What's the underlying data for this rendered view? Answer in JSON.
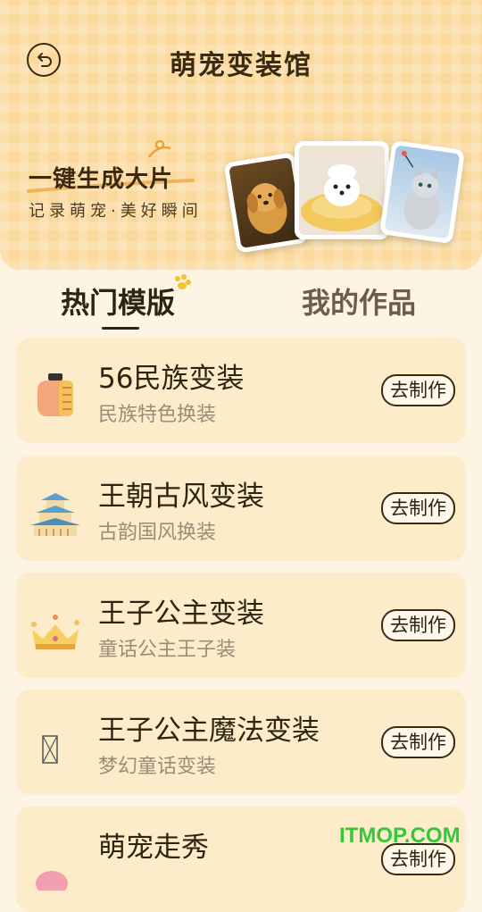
{
  "header": {
    "title": "萌宠变装馆",
    "back_icon": "back-arrow-icon",
    "banner": {
      "title": "一键生成大片",
      "subtitle": "记录萌宠·美好瞬间",
      "photos": [
        "golden-retriever-puppy",
        "white-puppy-in-bed",
        "kitten-with-toy"
      ]
    }
  },
  "tabs": [
    {
      "label": "热门模版",
      "active": true
    },
    {
      "label": "我的作品",
      "active": false
    }
  ],
  "templates": [
    {
      "name": "56民族变装",
      "desc": "民族特色换装",
      "action": "去制作",
      "icon": "ethnic-drum-icon"
    },
    {
      "name": "王朝古风变装",
      "desc": "古韵国风换装",
      "action": "去制作",
      "icon": "palace-icon"
    },
    {
      "name": "王子公主变装",
      "desc": "童话公主王子装",
      "action": "去制作",
      "icon": "crown-icon"
    },
    {
      "name": "王子公主魔法变装",
      "desc": "梦幻童话变装",
      "action": "去制作",
      "icon": "broken-image-icon"
    },
    {
      "name": "萌宠走秀",
      "desc": "",
      "action": "去制作",
      "icon": "pet-icon"
    }
  ],
  "watermark": "ITMOP.COM",
  "colors": {
    "accent": "#fbd99c",
    "card": "#fcecc9",
    "text": "#2e2414",
    "watermark": "#35c83a"
  }
}
